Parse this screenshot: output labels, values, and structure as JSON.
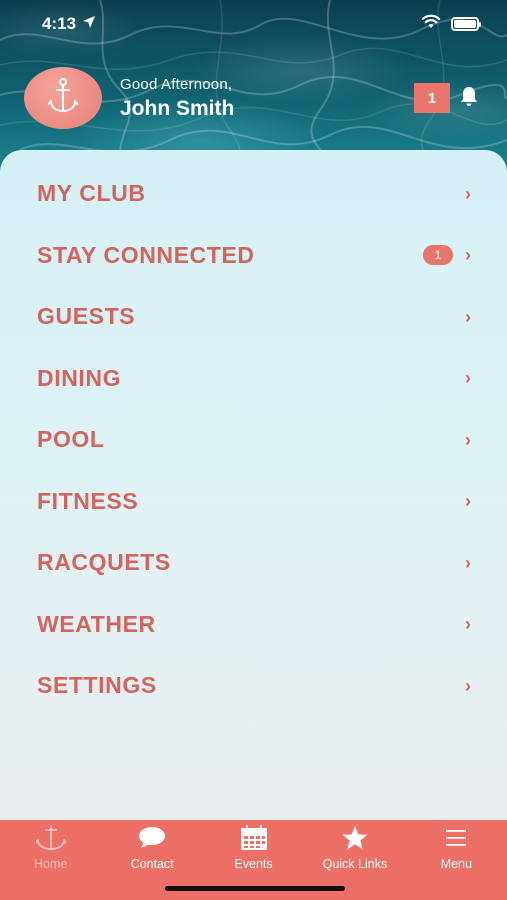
{
  "status_bar": {
    "time": "4:13",
    "location_icon": "location-arrow-icon",
    "wifi_icon": "wifi-icon",
    "battery_icon": "battery-icon"
  },
  "header": {
    "greeting": "Good Afternoon,",
    "user_name": "John Smith",
    "notification_count": "1",
    "avatar_icon": "anchor-icon",
    "bell_icon": "bell-icon"
  },
  "menu": {
    "items": [
      {
        "label": "MY CLUB",
        "badge": ""
      },
      {
        "label": "STAY CONNECTED",
        "badge": "1"
      },
      {
        "label": "GUESTS",
        "badge": ""
      },
      {
        "label": "DINING",
        "badge": ""
      },
      {
        "label": "POOL",
        "badge": ""
      },
      {
        "label": "FITNESS",
        "badge": ""
      },
      {
        "label": "RACQUETS",
        "badge": ""
      },
      {
        "label": "WEATHER",
        "badge": ""
      },
      {
        "label": "SETTINGS",
        "badge": ""
      }
    ],
    "chevron": "›"
  },
  "tab_bar": {
    "tabs": [
      {
        "label": "Home",
        "icon": "anchor-icon",
        "active": false
      },
      {
        "label": "Contact",
        "icon": "chat-bubble-icon",
        "active": true
      },
      {
        "label": "Events",
        "icon": "calendar-icon",
        "active": true
      },
      {
        "label": "Quick Links",
        "icon": "star-icon",
        "active": true
      },
      {
        "label": "Menu",
        "icon": "hamburger-icon",
        "active": true
      }
    ]
  },
  "colors": {
    "accent": "#e9756c",
    "menu_text": "#d4645c",
    "card_bg": "#dff3f6"
  }
}
